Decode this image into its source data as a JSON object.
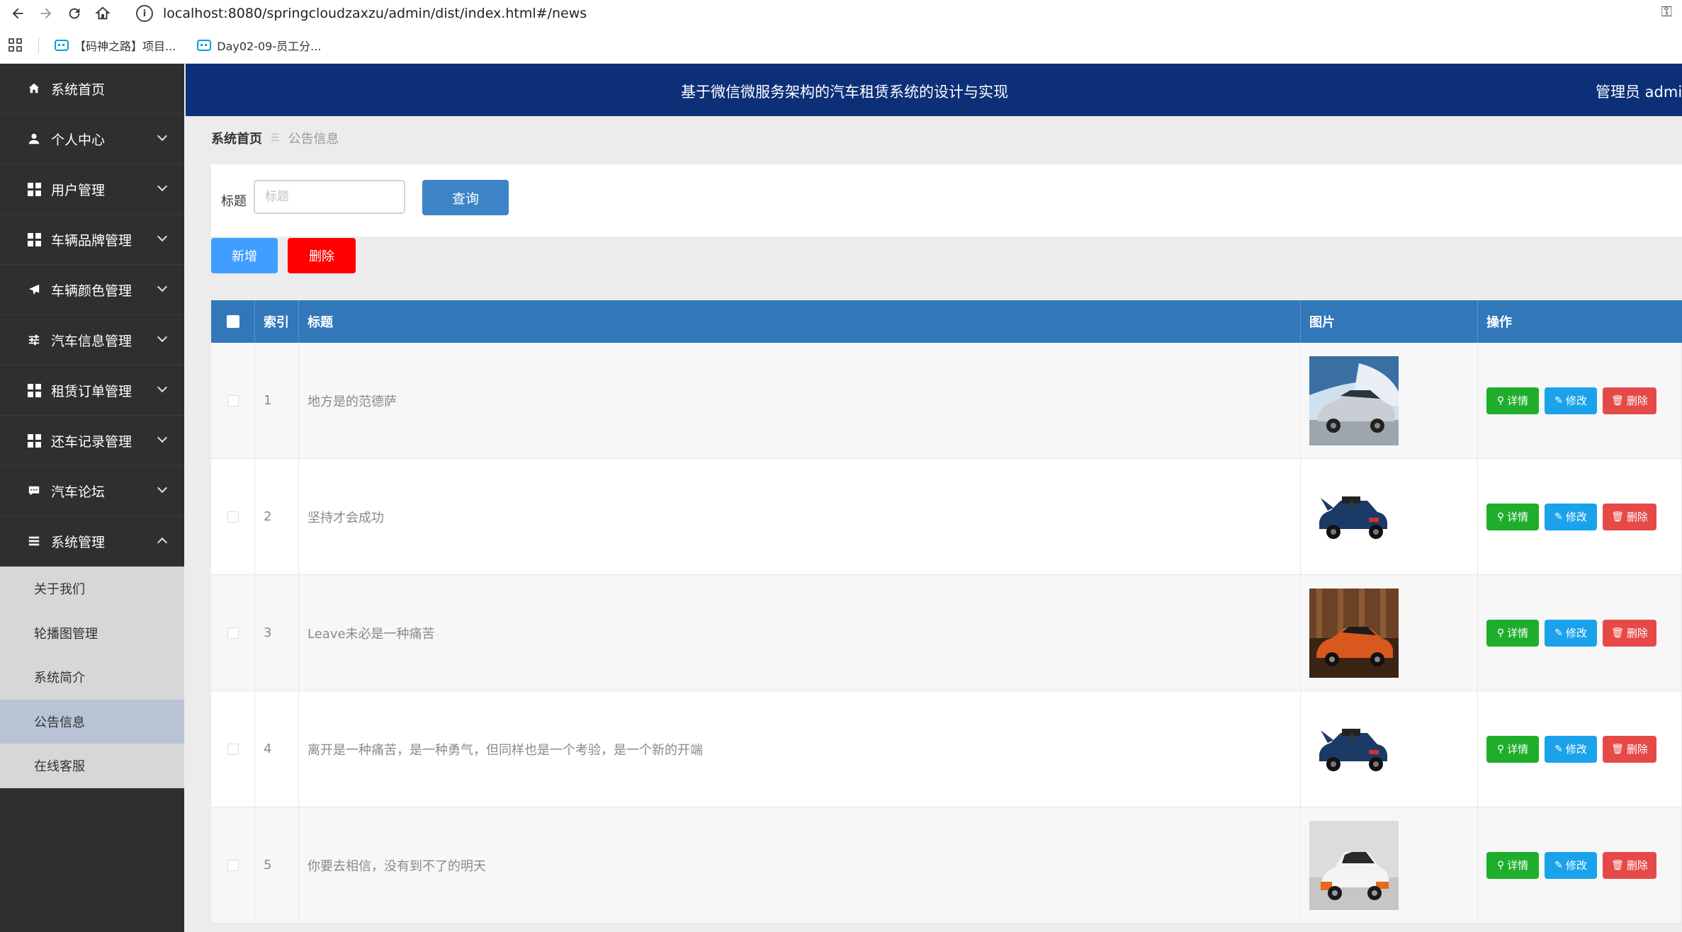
{
  "browser": {
    "url": "localhost:8080/springcloudzaxzu/admin/dist/index.html#/news",
    "bookmarks": [
      {
        "label": "【码神之路】项目..."
      },
      {
        "label": "Day02-09-员工分..."
      }
    ]
  },
  "header": {
    "title": "基于微信微服务架构的汽车租赁系统的设计与实现",
    "user": "管理员 admin"
  },
  "sidebar": {
    "items": [
      {
        "label": "系统首页",
        "icon": "home-icon"
      },
      {
        "label": "个人中心",
        "icon": "user-icon"
      },
      {
        "label": "用户管理",
        "icon": "grid-icon"
      },
      {
        "label": "车辆品牌管理",
        "icon": "grid-icon"
      },
      {
        "label": "车辆颜色管理",
        "icon": "paper-plane-icon"
      },
      {
        "label": "汽车信息管理",
        "icon": "sliders-icon"
      },
      {
        "label": "租赁订单管理",
        "icon": "grid-icon"
      },
      {
        "label": "还车记录管理",
        "icon": "grid-icon"
      },
      {
        "label": "汽车论坛",
        "icon": "chat-icon"
      },
      {
        "label": "系统管理",
        "icon": "list-icon"
      }
    ],
    "sub_items": [
      {
        "label": "关于我们"
      },
      {
        "label": "轮播图管理"
      },
      {
        "label": "系统简介"
      },
      {
        "label": "公告信息",
        "active": true
      },
      {
        "label": "在线客服"
      }
    ]
  },
  "breadcrumb": {
    "home": "系统首页",
    "current": "公告信息"
  },
  "search": {
    "label": "标题",
    "placeholder": "标题",
    "button": "查询"
  },
  "actions": {
    "add": "新增",
    "delete": "删除"
  },
  "table": {
    "headers": [
      "索引",
      "标题",
      "图片",
      "操作"
    ],
    "op_labels": {
      "detail": "详情",
      "edit": "修改",
      "delete": "删除"
    },
    "rows": [
      {
        "index": "1",
        "title": "地方是的范德萨",
        "image": "silver-suv"
      },
      {
        "index": "2",
        "title": "坚持才会成功",
        "image": "blue-toy-car"
      },
      {
        "index": "3",
        "title": "Leave未必是一种痛苦",
        "image": "orange-suv"
      },
      {
        "index": "4",
        "title": "离开是一种痛苦，是一种勇气，但同样也是一个考验，是一个新的开端",
        "image": "blue-toy-car"
      },
      {
        "index": "5",
        "title": "你要去相信，没有到不了的明天",
        "image": "white-orange-hatchback"
      }
    ]
  },
  "colors": {
    "sidebar_bg": "#2f2f2f",
    "header_bg": "#0d2f78",
    "table_header": "#3277ba",
    "detail": "#1fae2c",
    "edit": "#1aa3ea",
    "delete": "#e64a48"
  }
}
